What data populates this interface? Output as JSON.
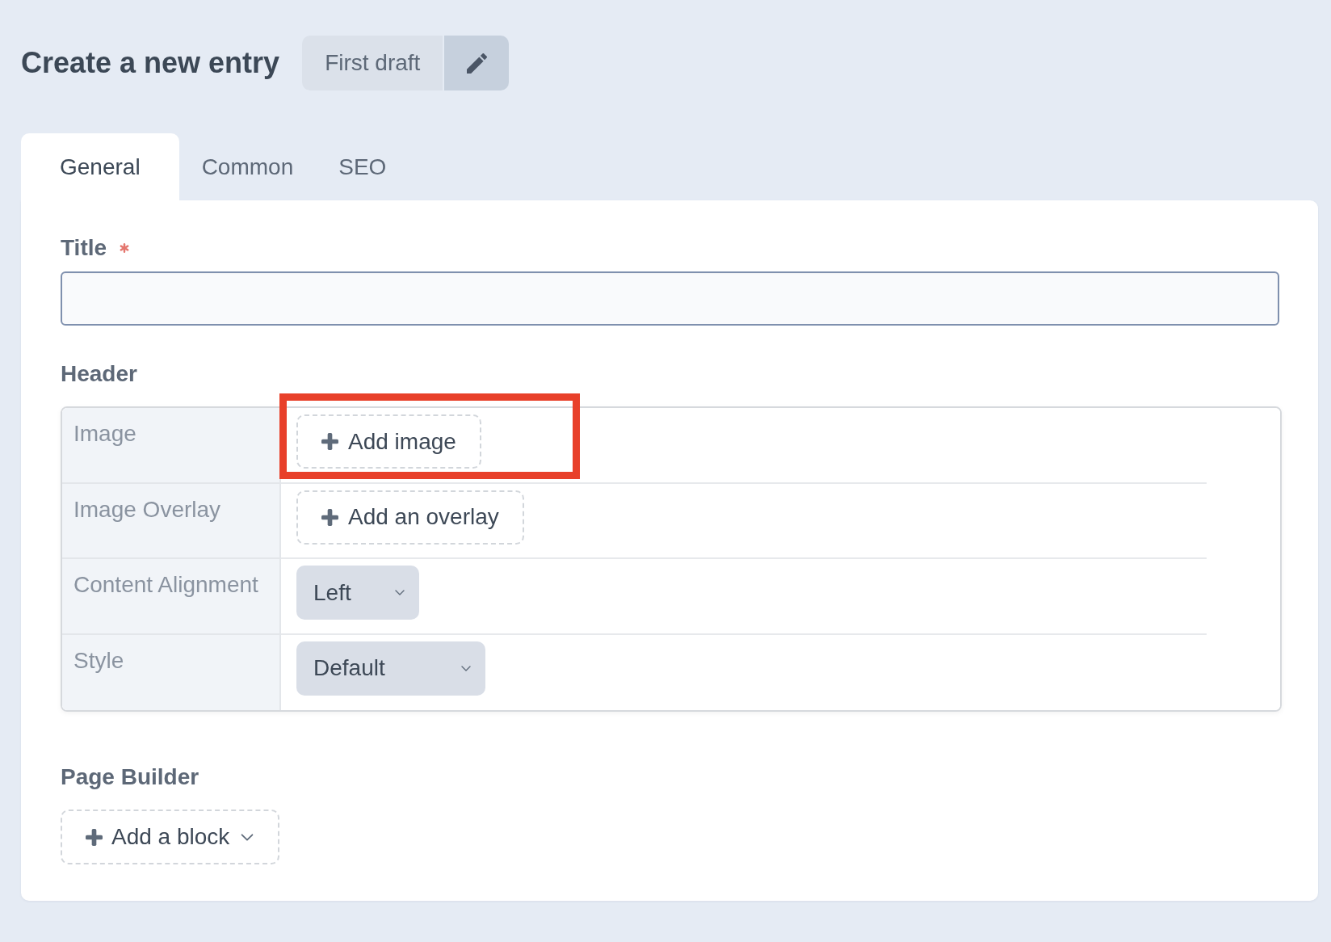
{
  "heading": "Create a new entry",
  "draft": {
    "label": "First draft"
  },
  "tabs": [
    {
      "label": "General",
      "selected": true
    },
    {
      "label": "Common",
      "selected": false
    },
    {
      "label": "SEO",
      "selected": false
    }
  ],
  "title_field": {
    "label": "Title",
    "required": true
  },
  "header": {
    "label": "Header",
    "rows": [
      {
        "label": "Image",
        "kind": "add",
        "button": "Add image",
        "highlighted": true
      },
      {
        "label": "Image Overlay",
        "kind": "add",
        "button": "Add an overlay",
        "highlighted": false
      },
      {
        "label": "Content Alignment",
        "kind": "select",
        "value": "Left",
        "highlighted": false
      },
      {
        "label": "Style",
        "kind": "select",
        "value": "Default",
        "highlighted": false
      }
    ]
  },
  "page_builder": {
    "label": "Page Builder",
    "button": "Add a block"
  }
}
